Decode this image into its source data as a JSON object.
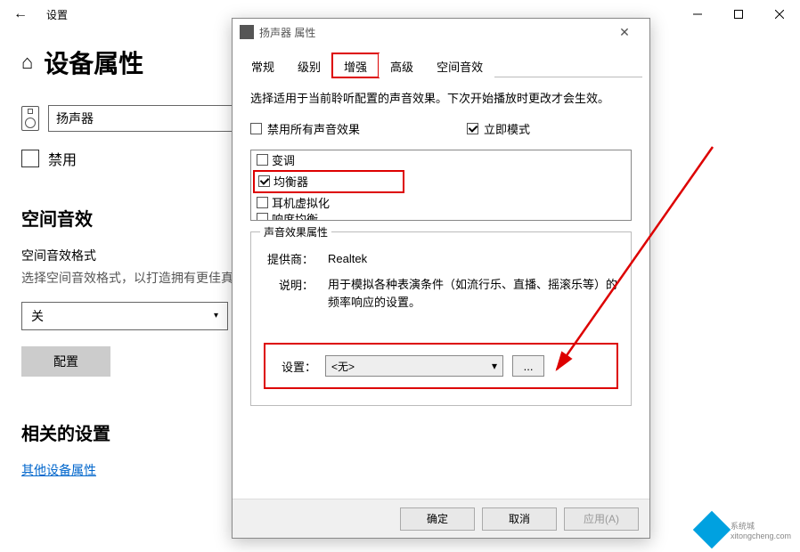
{
  "settings_window": {
    "caption": "设置",
    "heading": "设备属性",
    "device_name": "扬声器",
    "disable_label": "禁用",
    "disable_checked": false,
    "spatial_section": "空间音效",
    "spatial_format_label": "空间音效格式",
    "spatial_desc": "选择空间音效格式，以打造拥有更佳真验。",
    "spatial_value": "关",
    "configure_btn": "配置",
    "related_section": "相关的设置",
    "related_link": "其他设备属性"
  },
  "dialog": {
    "title": "扬声器 属性",
    "tabs": [
      "常规",
      "级别",
      "增强",
      "高级",
      "空间音效"
    ],
    "active_tab_index": 2,
    "instruction": "选择适用于当前聆听配置的声音效果。下次开始播放时更改才会生效。",
    "disable_all": {
      "label": "禁用所有声音效果",
      "checked": false
    },
    "immediate_mode": {
      "label": "立即模式",
      "checked": true
    },
    "enhancements": [
      {
        "label": "变调",
        "checked": false
      },
      {
        "label": "均衡器",
        "checked": true
      },
      {
        "label": "耳机虚拟化",
        "checked": false
      },
      {
        "label": "响度均衡",
        "checked": false
      }
    ],
    "props_group_legend": "声音效果属性",
    "provider_label": "提供商：",
    "provider_value": "Realtek",
    "desc_label": "说明：",
    "desc_value": "用于模拟各种表演条件（如流行乐、直播、摇滚乐等）的频率响应的设置。",
    "settings_label": "设置：",
    "settings_combo_value": "<无>",
    "more_btn": "...",
    "ok_btn": "确定",
    "cancel_btn": "取消",
    "apply_btn": "应用(A)"
  },
  "watermark": {
    "brand": "系统城",
    "url": "xitongcheng.com"
  }
}
